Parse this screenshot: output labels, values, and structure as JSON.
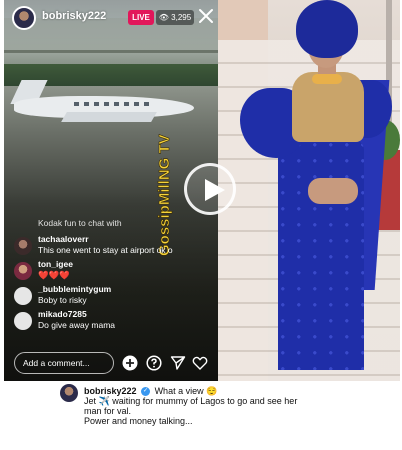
{
  "header": {
    "username": "bobrisky222",
    "live_label": "LIVE",
    "viewer_count": "3,295"
  },
  "watermark": "GossipMillNG TV",
  "comments": [
    {
      "user": "",
      "text": "Kodak fun to chat with",
      "style": "system"
    },
    {
      "user": "tachaaloverr",
      "text": "This one went to stay at airport ok o",
      "style": "normal"
    },
    {
      "user": "ton_igee",
      "text": "❤️❤️❤️",
      "style": "normal"
    },
    {
      "user": "_bubblemintygum",
      "text": "Boby to risky",
      "style": "normal"
    },
    {
      "user": "mikado7285",
      "text": "Do give away mama",
      "style": "normal"
    }
  ],
  "composer": {
    "placeholder": "Add a comment..."
  },
  "caption": {
    "username": "bobrisky222",
    "line1": "What a view 😌",
    "line2": "Jet ✈️ waiting for mummy of Lagos to go and see her",
    "line3": "man for val.",
    "line4": "Power and money talking..."
  },
  "colors": {
    "live_red": "#e2175a",
    "dress_blue": "#1f2ea8",
    "watermark_yellow": "#f5d33a"
  }
}
